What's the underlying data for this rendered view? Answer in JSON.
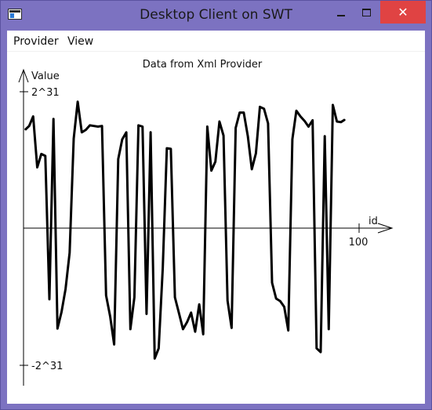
{
  "window": {
    "title": "Desktop Client on SWT",
    "close_glyph": "✕"
  },
  "menu": {
    "items": [
      "Provider",
      "View"
    ]
  },
  "chart_data": {
    "type": "line",
    "title": "Data from Xml Provider",
    "xlabel": "id",
    "ylabel": "Value",
    "y_ticks": [
      "2^31",
      "-2^31"
    ],
    "x_ticks": [
      "100"
    ],
    "xlim": [
      0,
      100
    ],
    "ylim": [
      -2147483648,
      2147483648
    ],
    "x": [
      0,
      1,
      2,
      3,
      4,
      5,
      6,
      7,
      8,
      9,
      10,
      11,
      12,
      13,
      14,
      15,
      16,
      17,
      18,
      19,
      20,
      21,
      22,
      23,
      24,
      25,
      26,
      27,
      28,
      29,
      30,
      31,
      32,
      33,
      34,
      35,
      36,
      37,
      38,
      39,
      40,
      41,
      42,
      43,
      44,
      45,
      46,
      47,
      48,
      49,
      50,
      51,
      52,
      53,
      54,
      55,
      56,
      57,
      58,
      59,
      60,
      61,
      62,
      63,
      64,
      65,
      66,
      67,
      68,
      69,
      70,
      71,
      72,
      73,
      74,
      75,
      76,
      77,
      78,
      79,
      80,
      81,
      82,
      83,
      84,
      85,
      86,
      87,
      88,
      89,
      90,
      91,
      92,
      93,
      94,
      95,
      96,
      97,
      98,
      99
    ],
    "y": [
      1550000000,
      1610000000,
      1760000000,
      960000000,
      1170000000,
      1140000000,
      -1110000000,
      1720000000,
      -1570000000,
      -1310000000,
      -950000000,
      -380000000,
      1410000000,
      1990000000,
      1510000000,
      1550000000,
      1620000000,
      1610000000,
      1600000000,
      1610000000,
      -1050000000,
      -1380000000,
      -1820000000,
      1090000000,
      1400000000,
      1510000000,
      -1580000000,
      -1080000000,
      1620000000,
      1600000000,
      -1340000000,
      1510000000,
      -2040000000,
      -1880000000,
      -620000000,
      1260000000,
      1250000000,
      -1080000000,
      -1330000000,
      -1580000000,
      -1470000000,
      -1320000000,
      -1620000000,
      -1190000000,
      -1660000000,
      1600000000,
      910000000,
      1050000000,
      1680000000,
      1460000000,
      -1130000000,
      -1560000000,
      1580000000,
      1820000000,
      1820000000,
      1450000000,
      930000000,
      1180000000,
      1910000000,
      1880000000,
      1650000000,
      -850000000,
      -1100000000,
      -1140000000,
      -1230000000,
      -1600000000,
      1400000000,
      1850000000,
      1760000000,
      1690000000,
      1600000000,
      1700000000,
      -1880000000,
      -1940000000,
      1450000000,
      -1580000000,
      1940000000,
      1680000000,
      1670000000,
      1710000000
    ]
  }
}
